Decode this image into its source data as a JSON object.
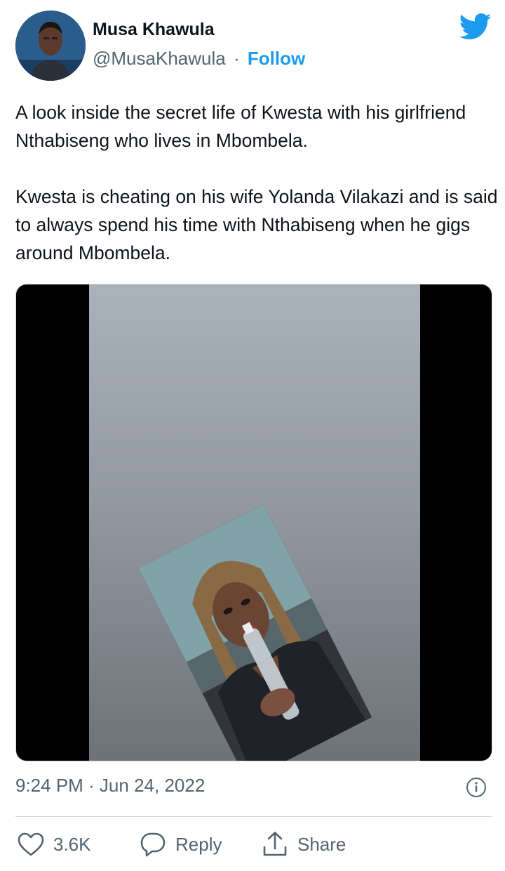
{
  "author": {
    "name": "Musa Khawula",
    "handle": "@MusaKhawula",
    "separator": "·",
    "follow_label": "Follow"
  },
  "tweet": {
    "paragraphs": [
      "A look inside the secret life of Kwesta with his girlfriend Nthabiseng who lives in Mbombela.",
      "Kwesta is cheating on his wife Yolanda Vilakazi and is said to always spend his time with Nthabiseng when he gigs around Mbombela."
    ],
    "timestamp": "9:24 PM · Jun 24, 2022"
  },
  "actions": {
    "like_count": "3.6K",
    "reply_label": "Reply",
    "share_label": "Share"
  },
  "icons": {
    "brand": "twitter-bird-icon",
    "like": "heart-icon",
    "reply": "speech-bubble-icon",
    "share": "share-upload-icon",
    "info": "info-icon"
  },
  "colors": {
    "accent": "#1d9bf0",
    "text": "#0f1419",
    "secondary_text": "#536471",
    "divider": "#cfd9de"
  }
}
